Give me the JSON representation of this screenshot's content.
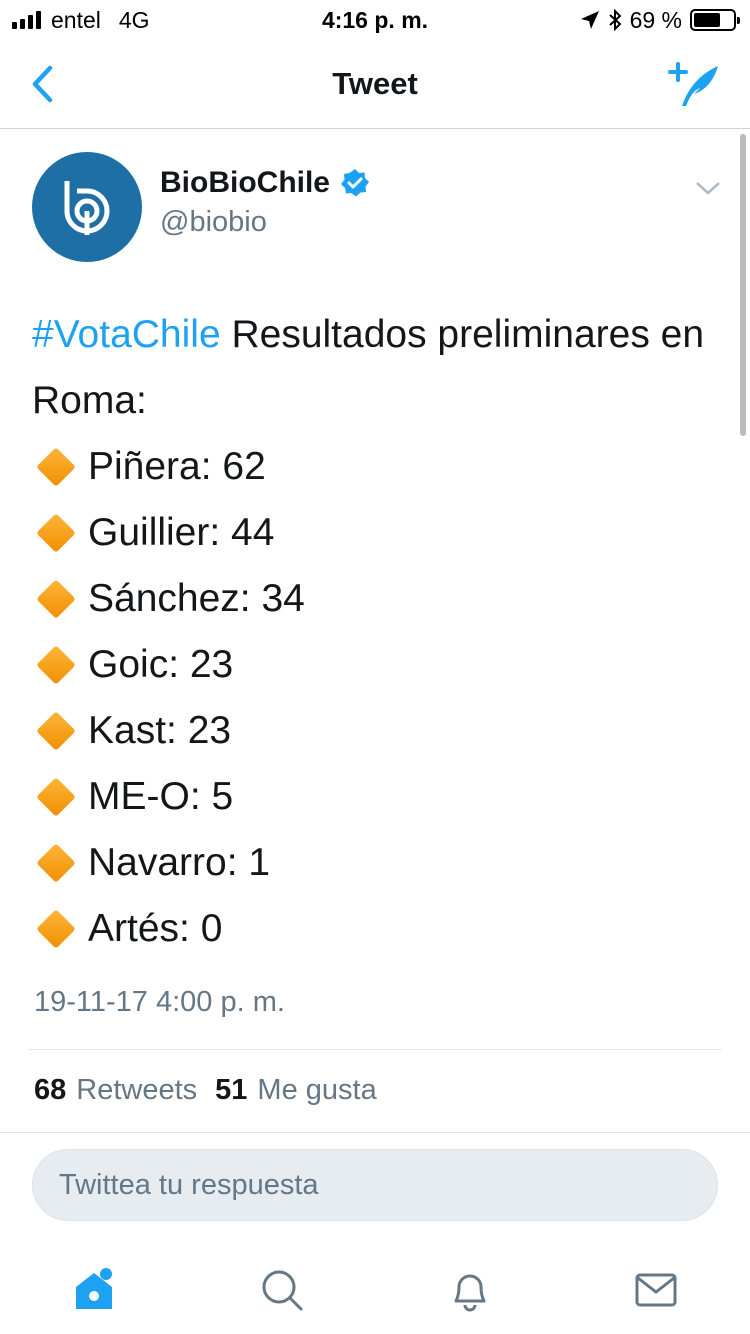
{
  "status_bar": {
    "carrier": "entel",
    "network": "4G",
    "time": "4:16 p. m.",
    "battery_percent_text": "69 %",
    "battery_level": 0.69
  },
  "nav": {
    "title": "Tweet",
    "back_icon": "chevron-left-icon",
    "compose_icon": "compose-tweet-icon"
  },
  "tweet": {
    "author": {
      "display_name": "BioBioChile",
      "handle": "@biobio",
      "verified": true
    },
    "text": {
      "hashtag": "#VotaChile",
      "intro_rest": " Resultados preliminares en Roma:"
    },
    "results": [
      "Piñera: 62",
      "Guillier: 44",
      "Sánchez: 34",
      "Goic: 23",
      "Kast: 23",
      "ME-O: 5",
      "Navarro: 1",
      "Artés: 0"
    ],
    "timestamp": "19-11-17 4:00 p. m.",
    "stats": {
      "retweets_count": "68",
      "retweets_label": "Retweets",
      "likes_count": "51",
      "likes_label": "Me gusta"
    }
  },
  "reply": {
    "placeholder": "Twittea tu respuesta"
  },
  "tabs": [
    "home-icon",
    "search-icon",
    "notifications-icon",
    "messages-icon"
  ],
  "colors": {
    "accent": "#1da1f2",
    "avatar_bg": "#1f6fa7",
    "secondary_text": "#657786",
    "diamond": "#f5a623"
  }
}
